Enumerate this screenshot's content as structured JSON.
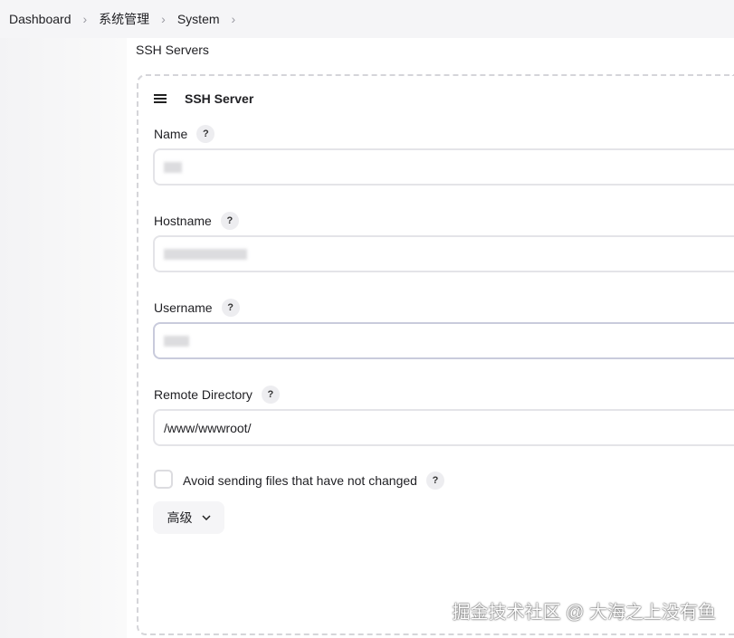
{
  "breadcrumb": [
    "Dashboard",
    "系统管理",
    "System"
  ],
  "section_title": "SSH Servers",
  "card": {
    "title": "SSH Server",
    "fields": [
      {
        "label": "Name",
        "value": "",
        "redacted": true
      },
      {
        "label": "Hostname",
        "value": "",
        "redacted": true
      },
      {
        "label": "Username",
        "value": "",
        "redacted": true
      },
      {
        "label": "Remote Directory",
        "value": "/www/wwwroot/"
      }
    ],
    "help": "?",
    "checkbox": {
      "label": "Avoid sending files that have not changed",
      "checked": false
    },
    "advanced_label": "高级"
  },
  "watermark": "掘金技术社区 @ 大海之上没有鱼"
}
